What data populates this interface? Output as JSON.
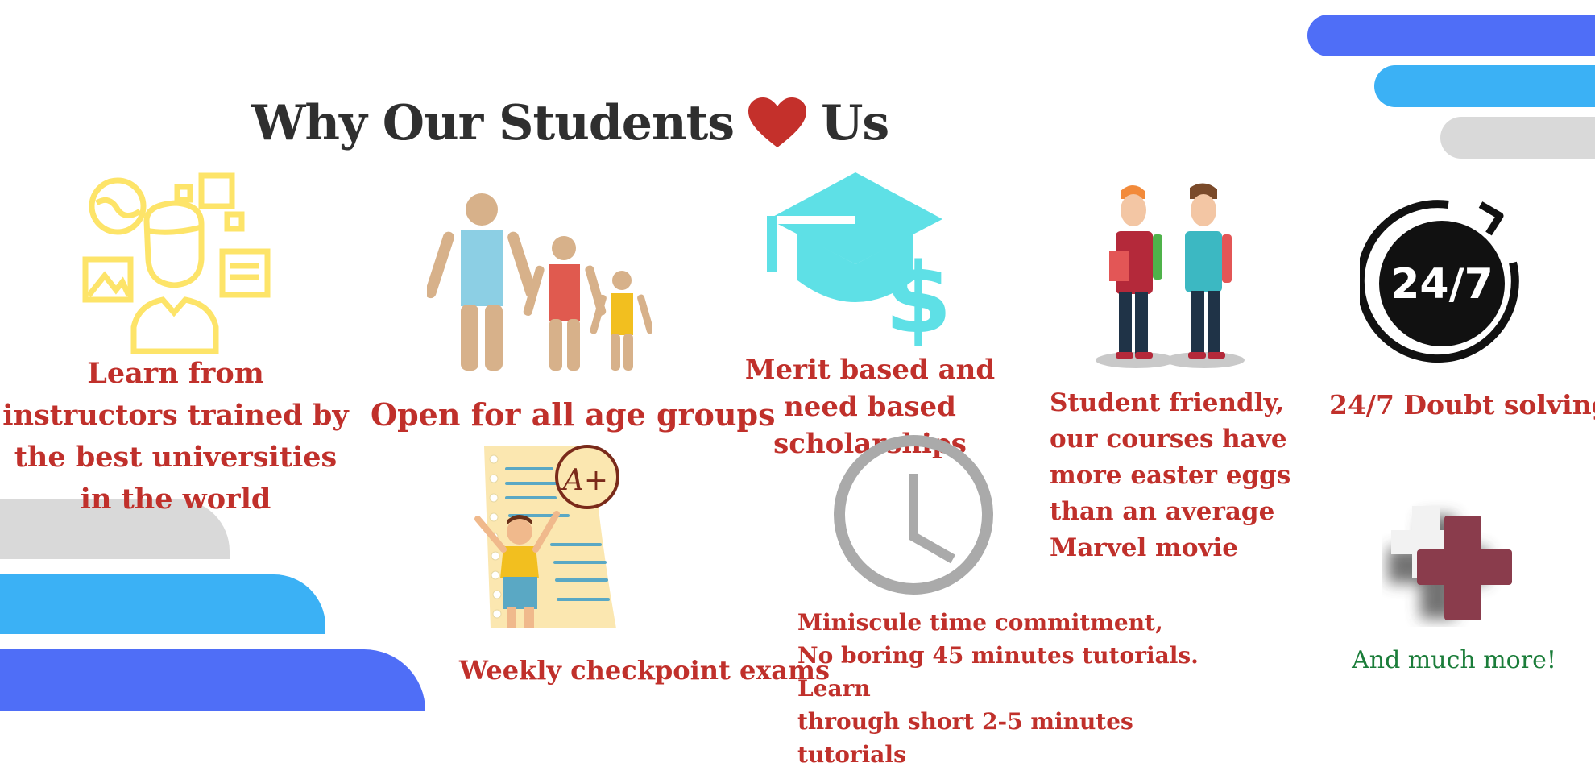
{
  "title": {
    "text_before": "Why Our Students",
    "text_after": "Us",
    "heart_icon": "heart-icon"
  },
  "colors": {
    "caption_red": "#c0302b",
    "title_dark": "#2f2f2f",
    "blue": "#4f6ef7",
    "light_blue": "#3bb1f5",
    "gray": "#d9d9d9",
    "green": "#1b7d3a",
    "yellow": "#fde469",
    "teal": "#5ee0e6"
  },
  "features": [
    {
      "icon": "instructor-icon",
      "caption": "Learn from instructors trained by the best universities in the world"
    },
    {
      "icon": "family-icon",
      "caption": "Open for all age groups"
    },
    {
      "icon": "graduation-scholarship-icon",
      "caption": "Merit based and need based scholarships"
    },
    {
      "icon": "students-icon",
      "caption": "Student friendly, our courses have more easter eggs than an average Marvel movie"
    },
    {
      "icon": "clock-24-7-icon",
      "caption": "24/7 Doubt solving",
      "badge": "24/7"
    },
    {
      "icon": "exam-icon",
      "caption": "Weekly checkpoint exams",
      "badge": "A+"
    },
    {
      "icon": "clock-icon",
      "caption_lines": [
        "Miniscule time commitment,",
        "No boring 45 minutes tutorials. Learn",
        "through short 2-5 minutes tutorials"
      ]
    },
    {
      "icon": "plus-icon",
      "caption": "And much more!"
    }
  ]
}
